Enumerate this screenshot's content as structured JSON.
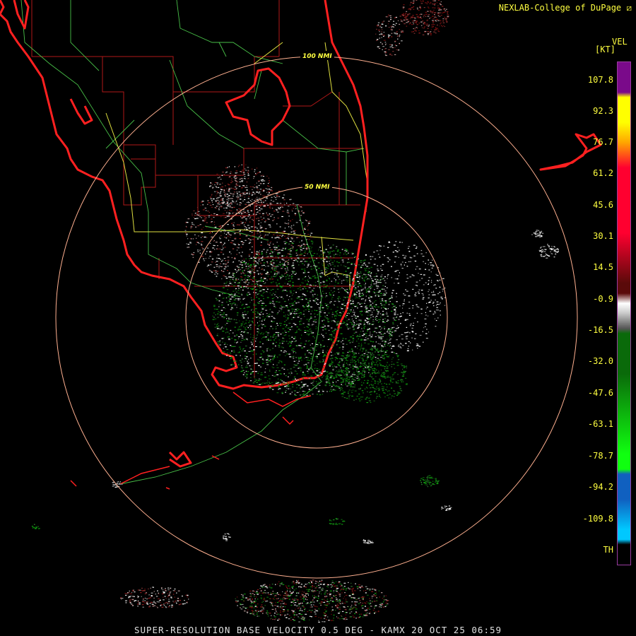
{
  "header": {
    "credit": "NEXLAB-College of DuPage ⧄"
  },
  "legend": {
    "product": "VEL",
    "unit": "[KT]",
    "ticks": [
      "107.8",
      "92.3",
      "76.7",
      "61.2",
      "45.6",
      "30.1",
      "14.5",
      "-0.9",
      "-16.5",
      "-32.0",
      "-47.6",
      "-63.1",
      "-78.7",
      "-94.2",
      "-109.8",
      "TH"
    ],
    "colors": {
      "top": "#7a0a8a",
      "yellow": "#ffff00",
      "orange": "#ffa500",
      "red": "#ff0030",
      "darkred": "#5a0a0a",
      "gray": "#c8c8c8",
      "darkgreen": "#0a6a0a",
      "green": "#10ff10",
      "blue": "#1060c0",
      "lightblue": "#00c8ff"
    }
  },
  "rings": {
    "label_100": "100 NMI",
    "label_50": "50 NMI"
  },
  "footer": {
    "caption": "SUPER-RESOLUTION BASE VELOCITY 0.5 DEG - KAMX 20 OCT 25 06:59"
  },
  "colors": {
    "coast": "#ff2020",
    "county": "#cc2020",
    "state_road": "#50c850",
    "highway": "#e8e840",
    "ring": "#ffb090"
  }
}
